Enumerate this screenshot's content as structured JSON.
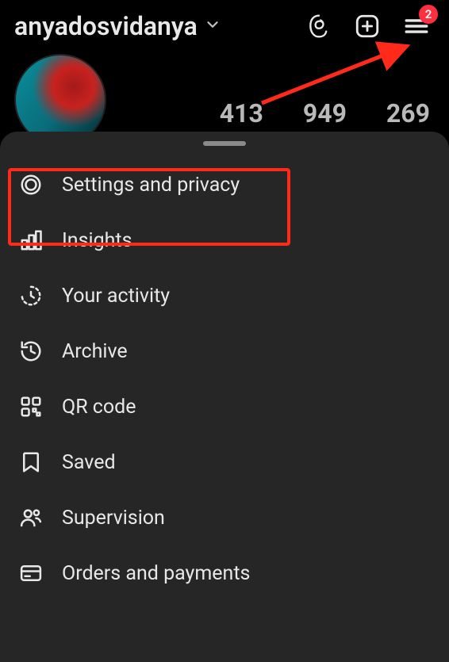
{
  "header": {
    "username": "anyadosvidanya",
    "notifications_badge": "2"
  },
  "stats": {
    "posts": "413",
    "followers": "949",
    "following": "269"
  },
  "menu": {
    "items": [
      {
        "label": "Settings and privacy",
        "icon": "gear-icon"
      },
      {
        "label": "Insights",
        "icon": "bar-chart-icon"
      },
      {
        "label": "Your activity",
        "icon": "activity-icon"
      },
      {
        "label": "Archive",
        "icon": "history-icon"
      },
      {
        "label": "QR code",
        "icon": "qr-icon"
      },
      {
        "label": "Saved",
        "icon": "bookmark-icon"
      },
      {
        "label": "Supervision",
        "icon": "people-icon"
      },
      {
        "label": "Orders and payments",
        "icon": "card-icon"
      }
    ]
  },
  "annotation": {
    "highlight_target": "settings-item",
    "arrow_target": "menu-button"
  }
}
